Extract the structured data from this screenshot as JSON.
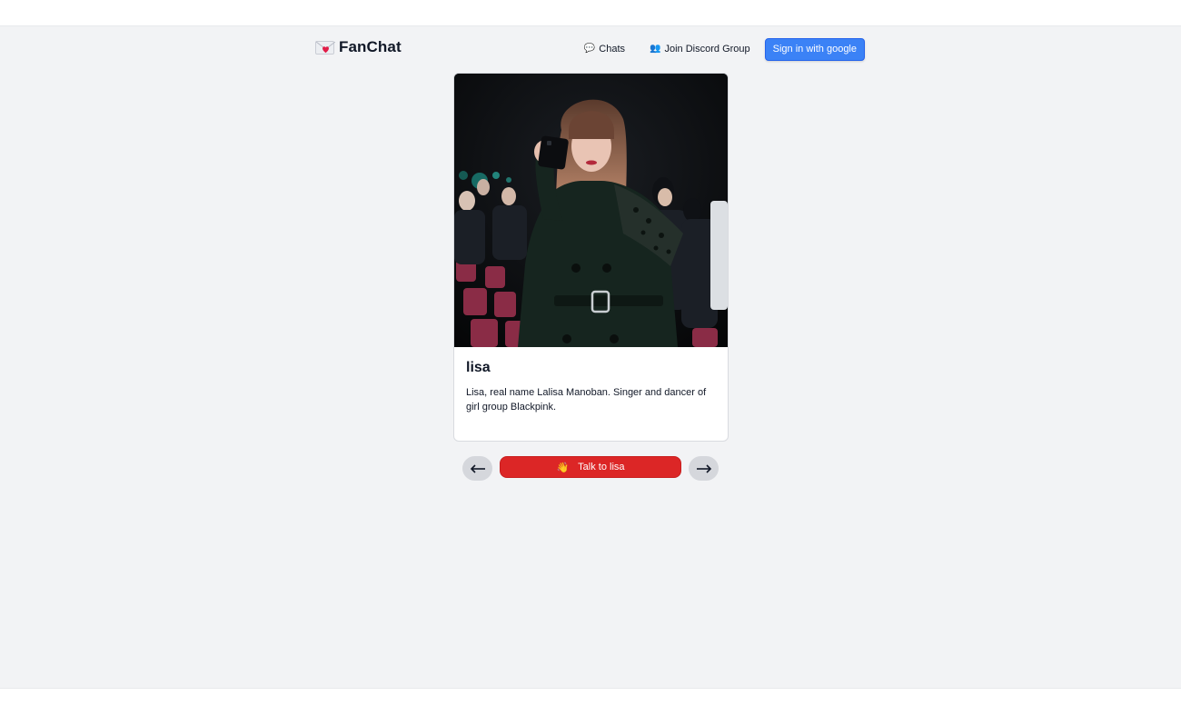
{
  "brand": {
    "name": "FanChat",
    "icon": "love-letter-icon"
  },
  "nav": {
    "chats": {
      "label": "Chats",
      "icon": "speech-bubble-icon"
    },
    "discord": {
      "label": "Join Discord Group",
      "icon": "people-icon"
    },
    "signin": {
      "label": "Sign in with google"
    }
  },
  "card": {
    "title": "lisa",
    "description": "Lisa, real name Lalisa Manoban. Singer and dancer of girl group Blackpink.",
    "image": "portrait-photo"
  },
  "controls": {
    "prev_icon": "arrow-left-icon",
    "next_icon": "arrow-right-icon",
    "talk_label": "Talk to lisa",
    "talk_icon": "waving-hand-icon"
  },
  "colors": {
    "page_bg": "#f2f3f5",
    "accent_blue": "#3b82f6",
    "accent_red": "#dc2626",
    "arrow_bg": "#d5d7dc"
  }
}
